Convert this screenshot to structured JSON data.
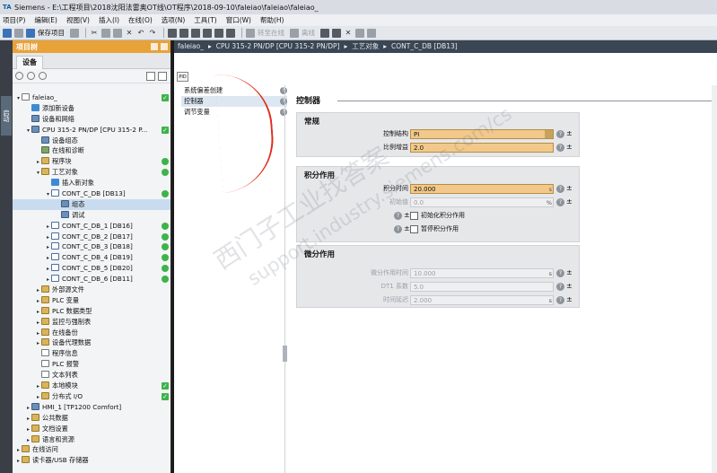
{
  "window": {
    "title": "Siemens  -  E:\\工程项目\\2018沈阳法雷奥OT线\\OT程序\\2018-09-10\\faleiao\\faleiao\\faleiao_"
  },
  "menu": [
    "项目(P)",
    "编辑(E)",
    "视图(V)",
    "插入(I)",
    "在线(O)",
    "选项(N)",
    "工具(T)",
    "窗口(W)",
    "帮助(H)"
  ],
  "toolbar": {
    "save_label": "保存项目",
    "online_label": "转至在线",
    "offline_label": "离线"
  },
  "left_strip": {
    "tab": "启动"
  },
  "panel": {
    "title": "项目树",
    "tab": "设备"
  },
  "tree": [
    {
      "label": "faleiao_",
      "indent": 0,
      "arrow": "▾",
      "icon": "doc",
      "status": "chk"
    },
    {
      "label": "添加新设备",
      "indent": 1,
      "arrow": "",
      "icon": "add",
      "status": ""
    },
    {
      "label": "设备和网络",
      "indent": 1,
      "arrow": "",
      "icon": "dev",
      "status": ""
    },
    {
      "label": "CPU 315-2 PN/DP [CPU 315-2 P...",
      "indent": 1,
      "arrow": "▾",
      "icon": "dev",
      "status": "chk"
    },
    {
      "label": "设备组态",
      "indent": 2,
      "arrow": "",
      "icon": "dev",
      "status": ""
    },
    {
      "label": "在线和诊断",
      "indent": 2,
      "arrow": "",
      "icon": "prg",
      "status": ""
    },
    {
      "label": "程序块",
      "indent": 2,
      "arrow": "▸",
      "icon": "fold",
      "status": "ok"
    },
    {
      "label": "工艺对象",
      "indent": 2,
      "arrow": "▾",
      "icon": "fold",
      "status": "ok"
    },
    {
      "label": "插入新对象",
      "indent": 3,
      "arrow": "",
      "icon": "add",
      "status": ""
    },
    {
      "label": "CONT_C_DB [DB13]",
      "indent": 3,
      "arrow": "▾",
      "icon": "db",
      "status": "ok"
    },
    {
      "label": "组态",
      "indent": 4,
      "arrow": "",
      "icon": "dev",
      "status": "",
      "selected": true
    },
    {
      "label": "调试",
      "indent": 4,
      "arrow": "",
      "icon": "dev",
      "status": ""
    },
    {
      "label": "CONT_C_DB_1 [DB16]",
      "indent": 3,
      "arrow": "▸",
      "icon": "db",
      "status": "ok"
    },
    {
      "label": "CONT_C_DB_2 [DB17]",
      "indent": 3,
      "arrow": "▸",
      "icon": "db",
      "status": "ok"
    },
    {
      "label": "CONT_C_DB_3 [DB18]",
      "indent": 3,
      "arrow": "▸",
      "icon": "db",
      "status": "ok"
    },
    {
      "label": "CONT_C_DB_4 [DB19]",
      "indent": 3,
      "arrow": "▸",
      "icon": "db",
      "status": "ok"
    },
    {
      "label": "CONT_C_DB_5 [DB20]",
      "indent": 3,
      "arrow": "▸",
      "icon": "db",
      "status": "ok"
    },
    {
      "label": "CONT_C_DB_6 [DB11]",
      "indent": 3,
      "arrow": "▸",
      "icon": "db",
      "status": "ok"
    },
    {
      "label": "外部源文件",
      "indent": 2,
      "arrow": "▸",
      "icon": "fold",
      "status": ""
    },
    {
      "label": "PLC 变量",
      "indent": 2,
      "arrow": "▸",
      "icon": "fold",
      "status": ""
    },
    {
      "label": "PLC 数据类型",
      "indent": 2,
      "arrow": "▸",
      "icon": "fold",
      "status": ""
    },
    {
      "label": "监控与强制表",
      "indent": 2,
      "arrow": "▸",
      "icon": "fold",
      "status": ""
    },
    {
      "label": "在线备份",
      "indent": 2,
      "arrow": "▸",
      "icon": "fold",
      "status": ""
    },
    {
      "label": "设备代理数据",
      "indent": 2,
      "arrow": "▸",
      "icon": "fold",
      "status": ""
    },
    {
      "label": "程序信息",
      "indent": 2,
      "arrow": "",
      "icon": "doc",
      "status": ""
    },
    {
      "label": "PLC 报警",
      "indent": 2,
      "arrow": "",
      "icon": "doc",
      "status": ""
    },
    {
      "label": "文本列表",
      "indent": 2,
      "arrow": "",
      "icon": "doc",
      "status": ""
    },
    {
      "label": "本地模块",
      "indent": 2,
      "arrow": "▸",
      "icon": "fold",
      "status": "chk"
    },
    {
      "label": "分布式 I/O",
      "indent": 2,
      "arrow": "▸",
      "icon": "fold",
      "status": "chk"
    },
    {
      "label": "HMI_1 [TP1200 Comfort]",
      "indent": 1,
      "arrow": "▸",
      "icon": "dev",
      "status": ""
    },
    {
      "label": "公共数据",
      "indent": 1,
      "arrow": "▸",
      "icon": "fold",
      "status": ""
    },
    {
      "label": "文档设置",
      "indent": 1,
      "arrow": "▸",
      "icon": "fold",
      "status": ""
    },
    {
      "label": "语言和资源",
      "indent": 1,
      "arrow": "▸",
      "icon": "fold",
      "status": ""
    },
    {
      "label": "在线访问",
      "indent": 0,
      "arrow": "▸",
      "icon": "fold",
      "status": ""
    },
    {
      "label": "读卡器/USB 存储器",
      "indent": 0,
      "arrow": "▸",
      "icon": "fold",
      "status": ""
    }
  ],
  "breadcrumb": [
    "faleiao_",
    "CPU 315-2 PN/DP [CPU 315-2 PN/DP]",
    "工艺对象",
    "CONT_C_DB [DB13]"
  ],
  "nav": [
    {
      "label": "系统偏差创建",
      "selected": false
    },
    {
      "label": "控制器",
      "selected": true
    },
    {
      "label": "调节变量",
      "selected": false
    }
  ],
  "content": {
    "title": "控制器",
    "general": {
      "title": "常规",
      "fields": [
        {
          "label": "控制结构",
          "value": "PI",
          "dropdown": true,
          "unit": "",
          "disabled": false
        },
        {
          "label": "比例增益",
          "value": "2.0",
          "dropdown": false,
          "unit": "",
          "disabled": false
        }
      ]
    },
    "integral": {
      "title": "积分作用",
      "fields": [
        {
          "label": "积分时间",
          "value": "20.000",
          "unit": "s",
          "disabled": false
        },
        {
          "label": "初始值",
          "value": "0.0",
          "unit": "%",
          "disabled": true
        }
      ],
      "checks": [
        "初始化积分作用",
        "暂停积分作用"
      ]
    },
    "derivative": {
      "title": "微分作用",
      "fields": [
        {
          "label": "微分作用时间",
          "value": "10.000",
          "unit": "s",
          "disabled": true
        },
        {
          "label": "DT1 系数",
          "value": "5.0",
          "unit": "",
          "disabled": true
        },
        {
          "label": "时间延迟",
          "value": "2.000",
          "unit": "s",
          "disabled": true
        }
      ]
    }
  },
  "watermark": {
    "line1": "西门子工业",
    "line2": "support.industry.siemens.com/cs",
    "line3": "找答案"
  },
  "colors": {
    "accent": "#e8a23a",
    "field_active": "#f2c98a",
    "status_ok": "#3db34a",
    "breadcrumb_bg": "#3b4654"
  }
}
